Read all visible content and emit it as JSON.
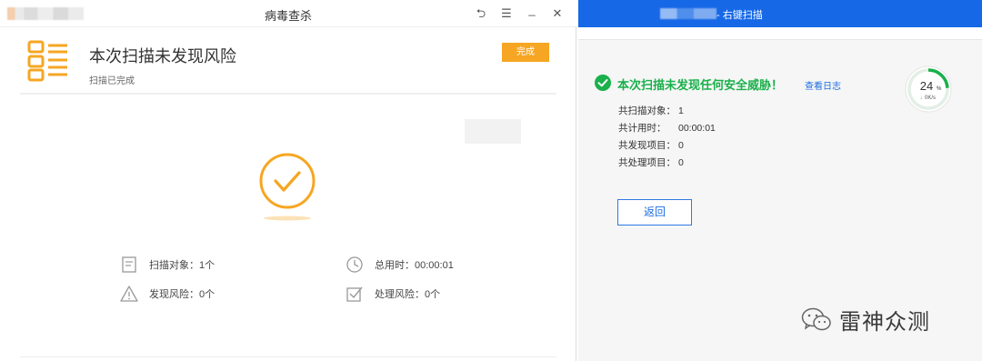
{
  "left_window": {
    "title": "病毒查杀",
    "controls": {
      "back": "⮌",
      "menu": "☰",
      "minimize": "_",
      "close": "✕"
    },
    "heading": "本次扫描未发现风险",
    "subheading": "扫描已完成",
    "done_button": "完成",
    "stats": {
      "scan_objects": "扫描对象：1个",
      "total_time": "总用时：00:00:01",
      "risks_found": "发现风险：0个",
      "risks_handled": "处理风险：0个"
    },
    "accent_color": "#f6a623"
  },
  "right_window": {
    "title": "- 右键扫描",
    "heading": "本次扫描未发现任何安全威胁！",
    "view_log_link": "查看日志",
    "gauge": {
      "percent_number": "24",
      "percent_sign": "%",
      "speed": "0K/s",
      "progress_fraction": 0.24
    },
    "rows": [
      {
        "label": "共扫描对象：",
        "value": "1"
      },
      {
        "label": "共计用时：",
        "value": "00:00:01"
      },
      {
        "label": "共发现项目：",
        "value": "0"
      },
      {
        "label": "共处理项目：",
        "value": "0"
      }
    ],
    "back_button": "返回",
    "titlebar_color": "#1668e6",
    "success_color": "#1ab04b"
  },
  "watermark": {
    "text": "雷神众测"
  }
}
